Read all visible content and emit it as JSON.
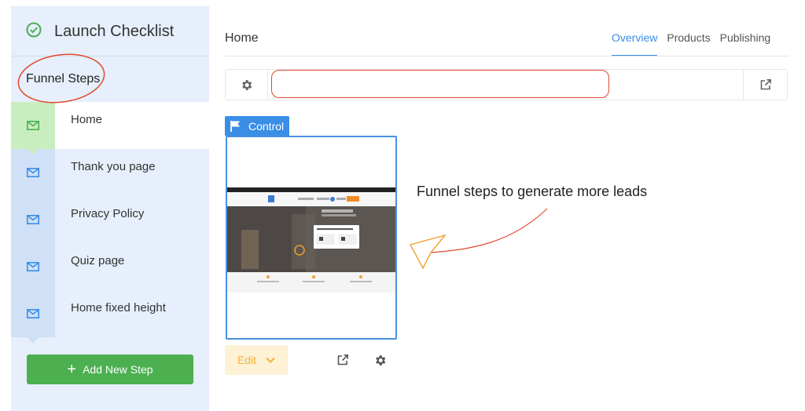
{
  "sidebar": {
    "checklist_title": "Launch Checklist",
    "steps_heading": "Funnel Steps",
    "steps": [
      {
        "label": "Home",
        "active": true
      },
      {
        "label": "Thank you page",
        "active": false
      },
      {
        "label": "Privacy Policy",
        "active": false
      },
      {
        "label": "Quiz page",
        "active": false
      },
      {
        "label": "Home fixed height",
        "active": false
      }
    ],
    "add_step_label": "Add New Step"
  },
  "main": {
    "title": "Home",
    "tabs": [
      {
        "label": "Overview",
        "active": true
      },
      {
        "label": "Products",
        "active": false
      },
      {
        "label": "Publishing",
        "active": false
      }
    ],
    "url_value": "",
    "control_label": "Control",
    "edit_label": "Edit"
  },
  "thumbnail": {
    "hero_text": "Let Us Create The Dream Kitchen You've Always Wanted"
  },
  "annotation": {
    "text": "Funnel steps to generate more leads"
  },
  "colors": {
    "accent_blue": "#3a8ee6",
    "green": "#4caf50",
    "annotation_red": "#e0492b",
    "edit_yellow": "#f2b233"
  }
}
